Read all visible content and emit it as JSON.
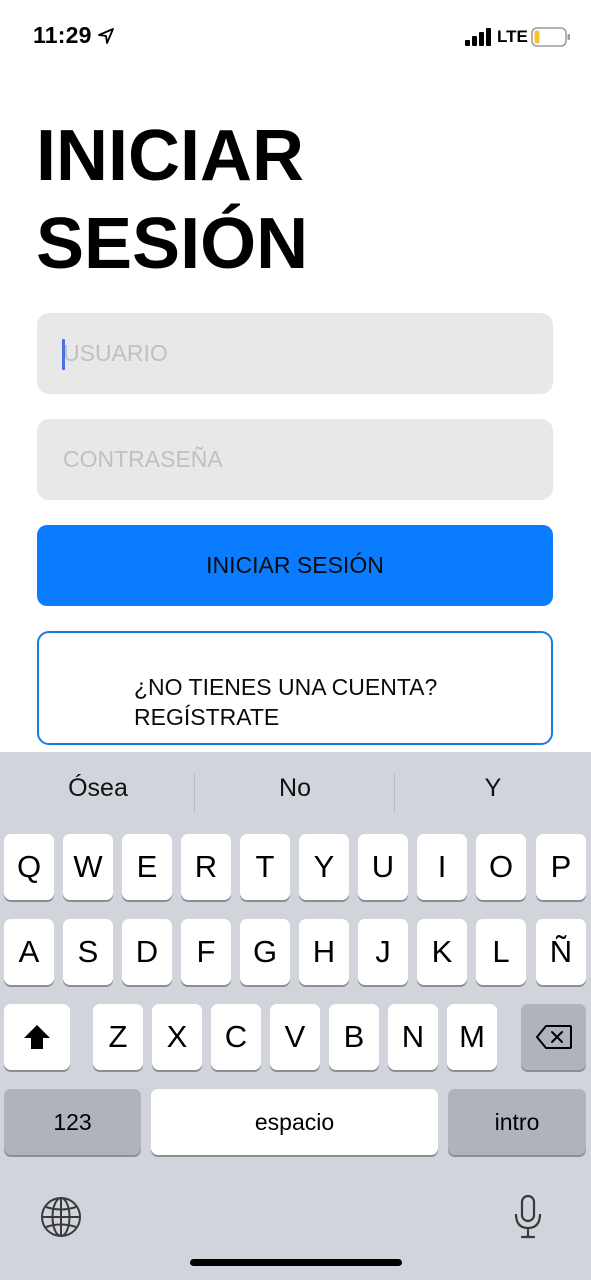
{
  "status_bar": {
    "time": "11:29",
    "network": "LTE",
    "location_icon": "location-arrow-icon",
    "signal_icon": "cellular-signal-icon",
    "battery_icon": "battery-low-icon",
    "battery_color": "#f4c430"
  },
  "page": {
    "title_line1": "INICIAR",
    "title_line2": "SESIÓN"
  },
  "form": {
    "username_placeholder": "USUARIO",
    "username_value": "",
    "password_placeholder": "CONTRASEÑA",
    "password_value": "",
    "login_label": "INICIAR SESIÓN",
    "register_line1": "¿NO TIENES UNA CUENTA?",
    "register_line2": "REGÍSTRATE",
    "accent_color": "#0a7cff"
  },
  "keyboard": {
    "suggestions": [
      "Ósea",
      "No",
      "Y"
    ],
    "row1": [
      "Q",
      "W",
      "E",
      "R",
      "T",
      "Y",
      "U",
      "I",
      "O",
      "P"
    ],
    "row2": [
      "A",
      "S",
      "D",
      "F",
      "G",
      "H",
      "J",
      "K",
      "L",
      "Ñ"
    ],
    "row3": [
      "Z",
      "X",
      "C",
      "V",
      "B",
      "N",
      "M"
    ],
    "numbers_label": "123",
    "space_label": "espacio",
    "return_label": "intro",
    "shift_icon": "shift-icon",
    "delete_icon": "backspace-icon",
    "globe_icon": "globe-icon",
    "mic_icon": "microphone-icon"
  }
}
